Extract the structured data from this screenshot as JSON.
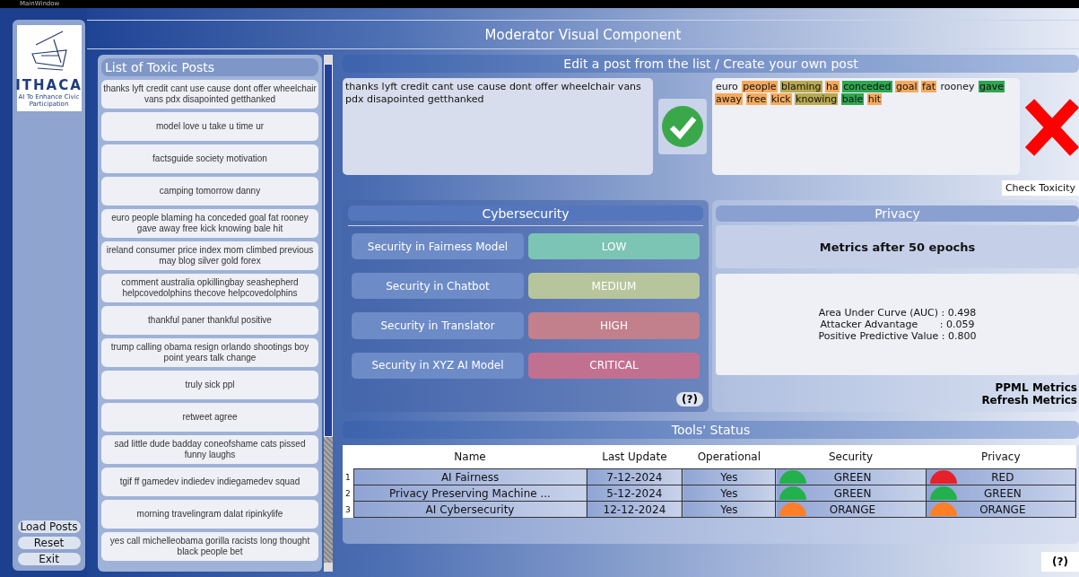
{
  "window": {
    "title": "MainWindow",
    "app_title": "Moderator Visual Component"
  },
  "sidebar": {
    "logo_text": "ITHACA",
    "logo_subtitle": "AI To Enhance Civic Participation",
    "buttons": [
      "Load Posts",
      "Reset",
      "Exit"
    ]
  },
  "post_list": {
    "title": "List of Toxic Posts",
    "items": [
      "thanks lyft credit cant use cause dont offer wheelchair vans pdx disapointed getthanked",
      "model love u take u time ur",
      "factsguide society motivation",
      "camping tomorrow danny",
      "euro people blaming ha conceded goal fat rooney gave away free kick knowing bale hit",
      "ireland consumer price index mom climbed previous may blog silver gold forex",
      "comment australia opkillingbay seashepherd helpcovedolphins thecove helpcovedolphins",
      "thankful paner thankful positive",
      "trump calling obama resign orlando shootings boy point years talk change",
      "truly sick ppl",
      "retweet agree",
      "sad little dude badday coneofshame cats pissed funny laughs",
      "tgif ff gamedev indiedev indiegamedev squad",
      "morning travelingram dalat ripinkylife",
      "yes call michelleobama gorilla racists long thought black people bet"
    ]
  },
  "editor": {
    "title": "Edit a post from the list / Create your own post",
    "input_text": "thanks lyft credit cant use cause dont offer wheelchair vans pdx disapointed getthanked",
    "result_words": [
      {
        "text": "euro"
      },
      {
        "text": "people",
        "color": "#f5a95c"
      },
      {
        "text": "blaming",
        "color": "#b8a850"
      },
      {
        "text": "ha",
        "color": "#f5a95c"
      },
      {
        "text": "conceded",
        "color": "#2fa650"
      },
      {
        "text": "goal",
        "color": "#f5a95c"
      },
      {
        "text": "fat",
        "color": "#f5a95c"
      },
      {
        "text": "rooney"
      },
      {
        "text": "gave",
        "color": "#2fa650"
      },
      {
        "text": "away",
        "color": "#f5a95c"
      },
      {
        "text": "free",
        "color": "#f5a95c"
      },
      {
        "text": "kick",
        "color": "#f5a95c"
      },
      {
        "text": "knowing",
        "color": "#b8a850"
      },
      {
        "text": "bale",
        "color": "#2fa650"
      },
      {
        "text": "hit",
        "color": "#f5a95c"
      }
    ],
    "check_button": "Check Toxicity"
  },
  "cybersecurity": {
    "title": "Cybersecurity",
    "rows": [
      {
        "label": "Security in Fairness Model",
        "level_text": "LOW",
        "color": "#7cc4b4"
      },
      {
        "label": "Security in Chatbot",
        "level_text": "MEDIUM",
        "color": "#b7c59c"
      },
      {
        "label": "Security in Translator",
        "level_text": "HIGH",
        "color": "#c27f8c"
      },
      {
        "label": "Security in XYZ AI Model",
        "level_text": "CRITICAL",
        "color": "#c27090"
      }
    ],
    "help_button": "(?)"
  },
  "privacy": {
    "title": "Privacy",
    "heading": "Metrics after 50 epochs",
    "metrics": [
      "Area Under Curve (AUC) : 0.498",
      "Attacker Advantage       : 0.059",
      "Positive Predictive Value : 0.800"
    ],
    "links": [
      "PPML Metrics",
      "Refresh Metrics"
    ]
  },
  "tools_status": {
    "title": "Tools' Status",
    "columns": [
      "Name",
      "Last Update",
      "Operational",
      "Security",
      "Privacy"
    ],
    "rows": [
      {
        "index": "1",
        "name": "AI Fairness",
        "last_update": "7-12-2024",
        "operational": "Yes",
        "security": {
          "text": "GREEN",
          "color": "#22b14c"
        },
        "privacy": {
          "text": "RED",
          "color": "#e8202a"
        }
      },
      {
        "index": "2",
        "name": "Privacy Preserving Machine ...",
        "last_update": "5-12-2024",
        "operational": "Yes",
        "security": {
          "text": "GREEN",
          "color": "#22b14c"
        },
        "privacy": {
          "text": "GREEN",
          "color": "#22b14c"
        }
      },
      {
        "index": "3",
        "name": "AI Cybersecurity",
        "last_update": "12-12-2024",
        "operational": "Yes",
        "security": {
          "text": "ORANGE",
          "color": "#ff7f27"
        },
        "privacy": {
          "text": "ORANGE",
          "color": "#ff7f27"
        }
      }
    ],
    "help_button": "(?)"
  }
}
